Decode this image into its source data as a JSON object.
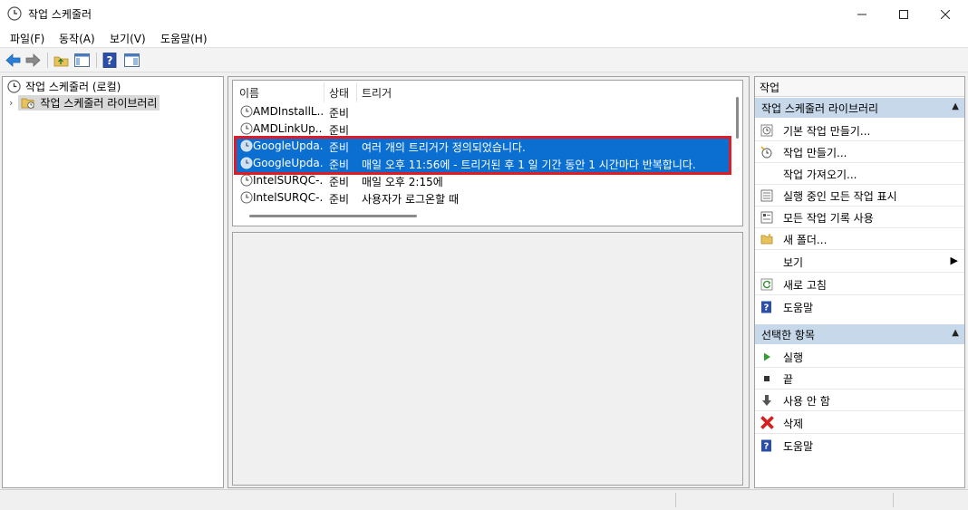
{
  "window": {
    "title": "작업 스케줄러"
  },
  "menu": [
    "파일(F)",
    "동작(A)",
    "보기(V)",
    "도움말(H)"
  ],
  "tree": {
    "root": "작업 스케줄러 (로컬)",
    "child": "작업 스케줄러 라이브러리"
  },
  "table": {
    "columns": [
      "이름",
      "상태",
      "트리거"
    ],
    "rows": [
      {
        "name": "AMDInstallL...",
        "status": "준비",
        "trigger": ""
      },
      {
        "name": "AMDLinkUp...",
        "status": "준비",
        "trigger": ""
      },
      {
        "name": "GoogleUpda...",
        "status": "준비",
        "trigger": "여러 개의 트리거가 정의되었습니다."
      },
      {
        "name": "GoogleUpda...",
        "status": "준비",
        "trigger": "매일 오후 11:56에 - 트리거된 후 1 일 기간 동안 1 시간마다 반복합니다."
      },
      {
        "name": "IntelSURQC-...",
        "status": "준비",
        "trigger": "매일 오후 2:15에"
      },
      {
        "name": "IntelSURQC-...",
        "status": "준비",
        "trigger": "사용자가 로그온할 때"
      }
    ]
  },
  "actions": {
    "title": "작업",
    "section1": "작업 스케줄러 라이브러리",
    "items1": [
      {
        "label": "기본 작업 만들기...",
        "icon": "basic-task-icon"
      },
      {
        "label": "작업 만들기...",
        "icon": "create-task-icon"
      },
      {
        "label": "작업 가져오기...",
        "icon": ""
      },
      {
        "label": "실행 중인 모든 작업 표시",
        "icon": "running-tasks-icon"
      },
      {
        "label": "모든 작업 기록 사용",
        "icon": "history-icon"
      },
      {
        "label": "새 폴더...",
        "icon": "folder-icon"
      },
      {
        "label": "보기",
        "icon": ""
      },
      {
        "label": "새로 고침",
        "icon": "refresh-icon"
      },
      {
        "label": "도움말",
        "icon": "help-icon"
      }
    ],
    "section2": "선택한 항목",
    "items2": [
      {
        "label": "실행",
        "icon": "run-icon"
      },
      {
        "label": "끝",
        "icon": "stop-icon"
      },
      {
        "label": "사용 안 함",
        "icon": "disable-icon"
      },
      {
        "label": "삭제",
        "icon": "delete-icon"
      },
      {
        "label": "도움말",
        "icon": "help-icon"
      }
    ]
  },
  "colors": {
    "selection": "#0a6fd1",
    "highlight": "#e01b24",
    "section": "#c7d8ea"
  }
}
